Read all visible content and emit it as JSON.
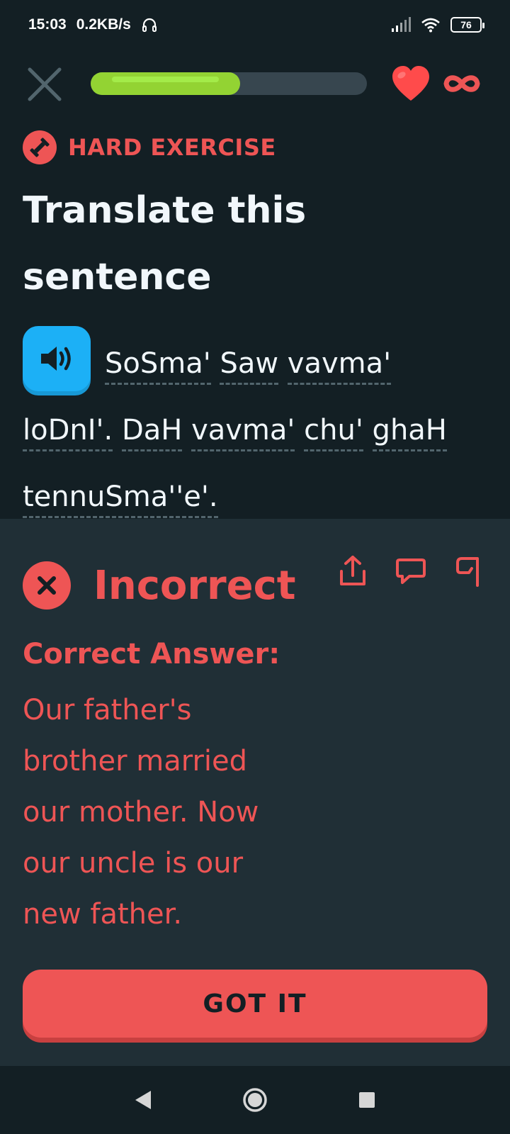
{
  "status_bar": {
    "time": "15:03",
    "speed": "0.2KB/s",
    "battery": "76"
  },
  "top_bar": {
    "progress_fraction": 0.54
  },
  "exercise": {
    "badge_label": "HARD EXERCISE",
    "title": "Translate this sentence",
    "sentence_words": [
      "SoSma'",
      "Saw",
      "vavma'",
      "loDnI'.",
      "DaH",
      "vavma'",
      "chu'",
      "ghaH",
      "tennuSma''e'."
    ]
  },
  "feedback": {
    "status": "Incorrect",
    "correct_label": "Correct Answer:",
    "correct_answer": "Our father's brother married our mother. Now our uncle is our new father.",
    "button_label": "GOT IT"
  },
  "colors": {
    "background": "#131f24",
    "panel": "#202f36",
    "error_red": "#ee5555",
    "progress_green": "#93d333",
    "speaker_blue": "#1cb0f6"
  },
  "icons": {
    "close": "close-icon",
    "heart": "heart-icon",
    "infinity": "infinity-icon",
    "dumbbell": "dumbbell-icon",
    "speaker": "speaker-icon",
    "incorrect": "x-circle-icon",
    "share": "share-icon",
    "comment": "comment-icon",
    "flag": "flag-icon"
  }
}
